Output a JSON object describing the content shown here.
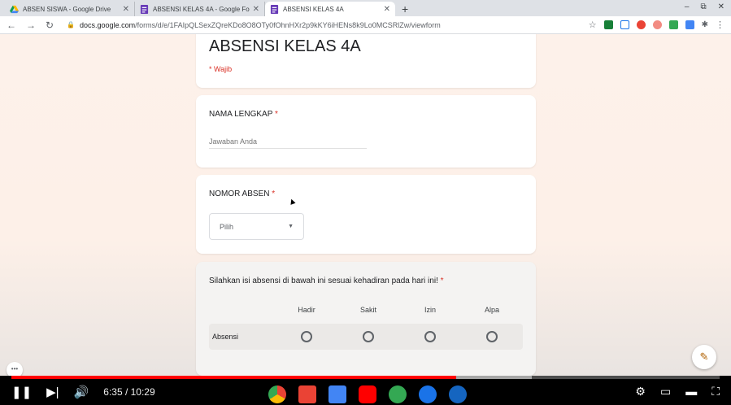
{
  "browser": {
    "tabs": [
      {
        "title": "ABSEN SISWA - Google Drive",
        "active": false,
        "icon": "google-drive-icon"
      },
      {
        "title": "ABSENSI KELAS 4A - Google Fo",
        "active": false,
        "icon": "google-forms-icon"
      },
      {
        "title": "ABSENSI KELAS 4A",
        "active": true,
        "icon": "google-forms-icon"
      }
    ],
    "new_tab": "+",
    "url_host": "docs.google.com",
    "url_path": "/forms/d/e/1FAIpQLSexZQreKDo8O8OTy0fOhnHXr2p9kKY6iHENs8k9Lo0MCSRlZw/viewform"
  },
  "form": {
    "title": "ABSENSI KELAS 4A",
    "required_note": "* Wajib",
    "q1": {
      "label": "NAMA LENGKAP",
      "star": "*",
      "placeholder": "Jawaban Anda"
    },
    "q2": {
      "label": "NOMOR ABSEN",
      "star": "*",
      "select_value": "Pilih"
    },
    "q3": {
      "label": "Silahkan isi absensi di bawah ini sesuai kehadiran pada hari ini!",
      "star": "*",
      "columns": [
        "Hadir",
        "Sakit",
        "Izin",
        "Alpa"
      ],
      "row_label": "Absensi"
    }
  },
  "player": {
    "time": "6:35 / 10:29",
    "progress_played": 0.628,
    "progress_buffered": 0.735
  },
  "colors": {
    "required": "#d93025",
    "progress": "#ff0000"
  }
}
